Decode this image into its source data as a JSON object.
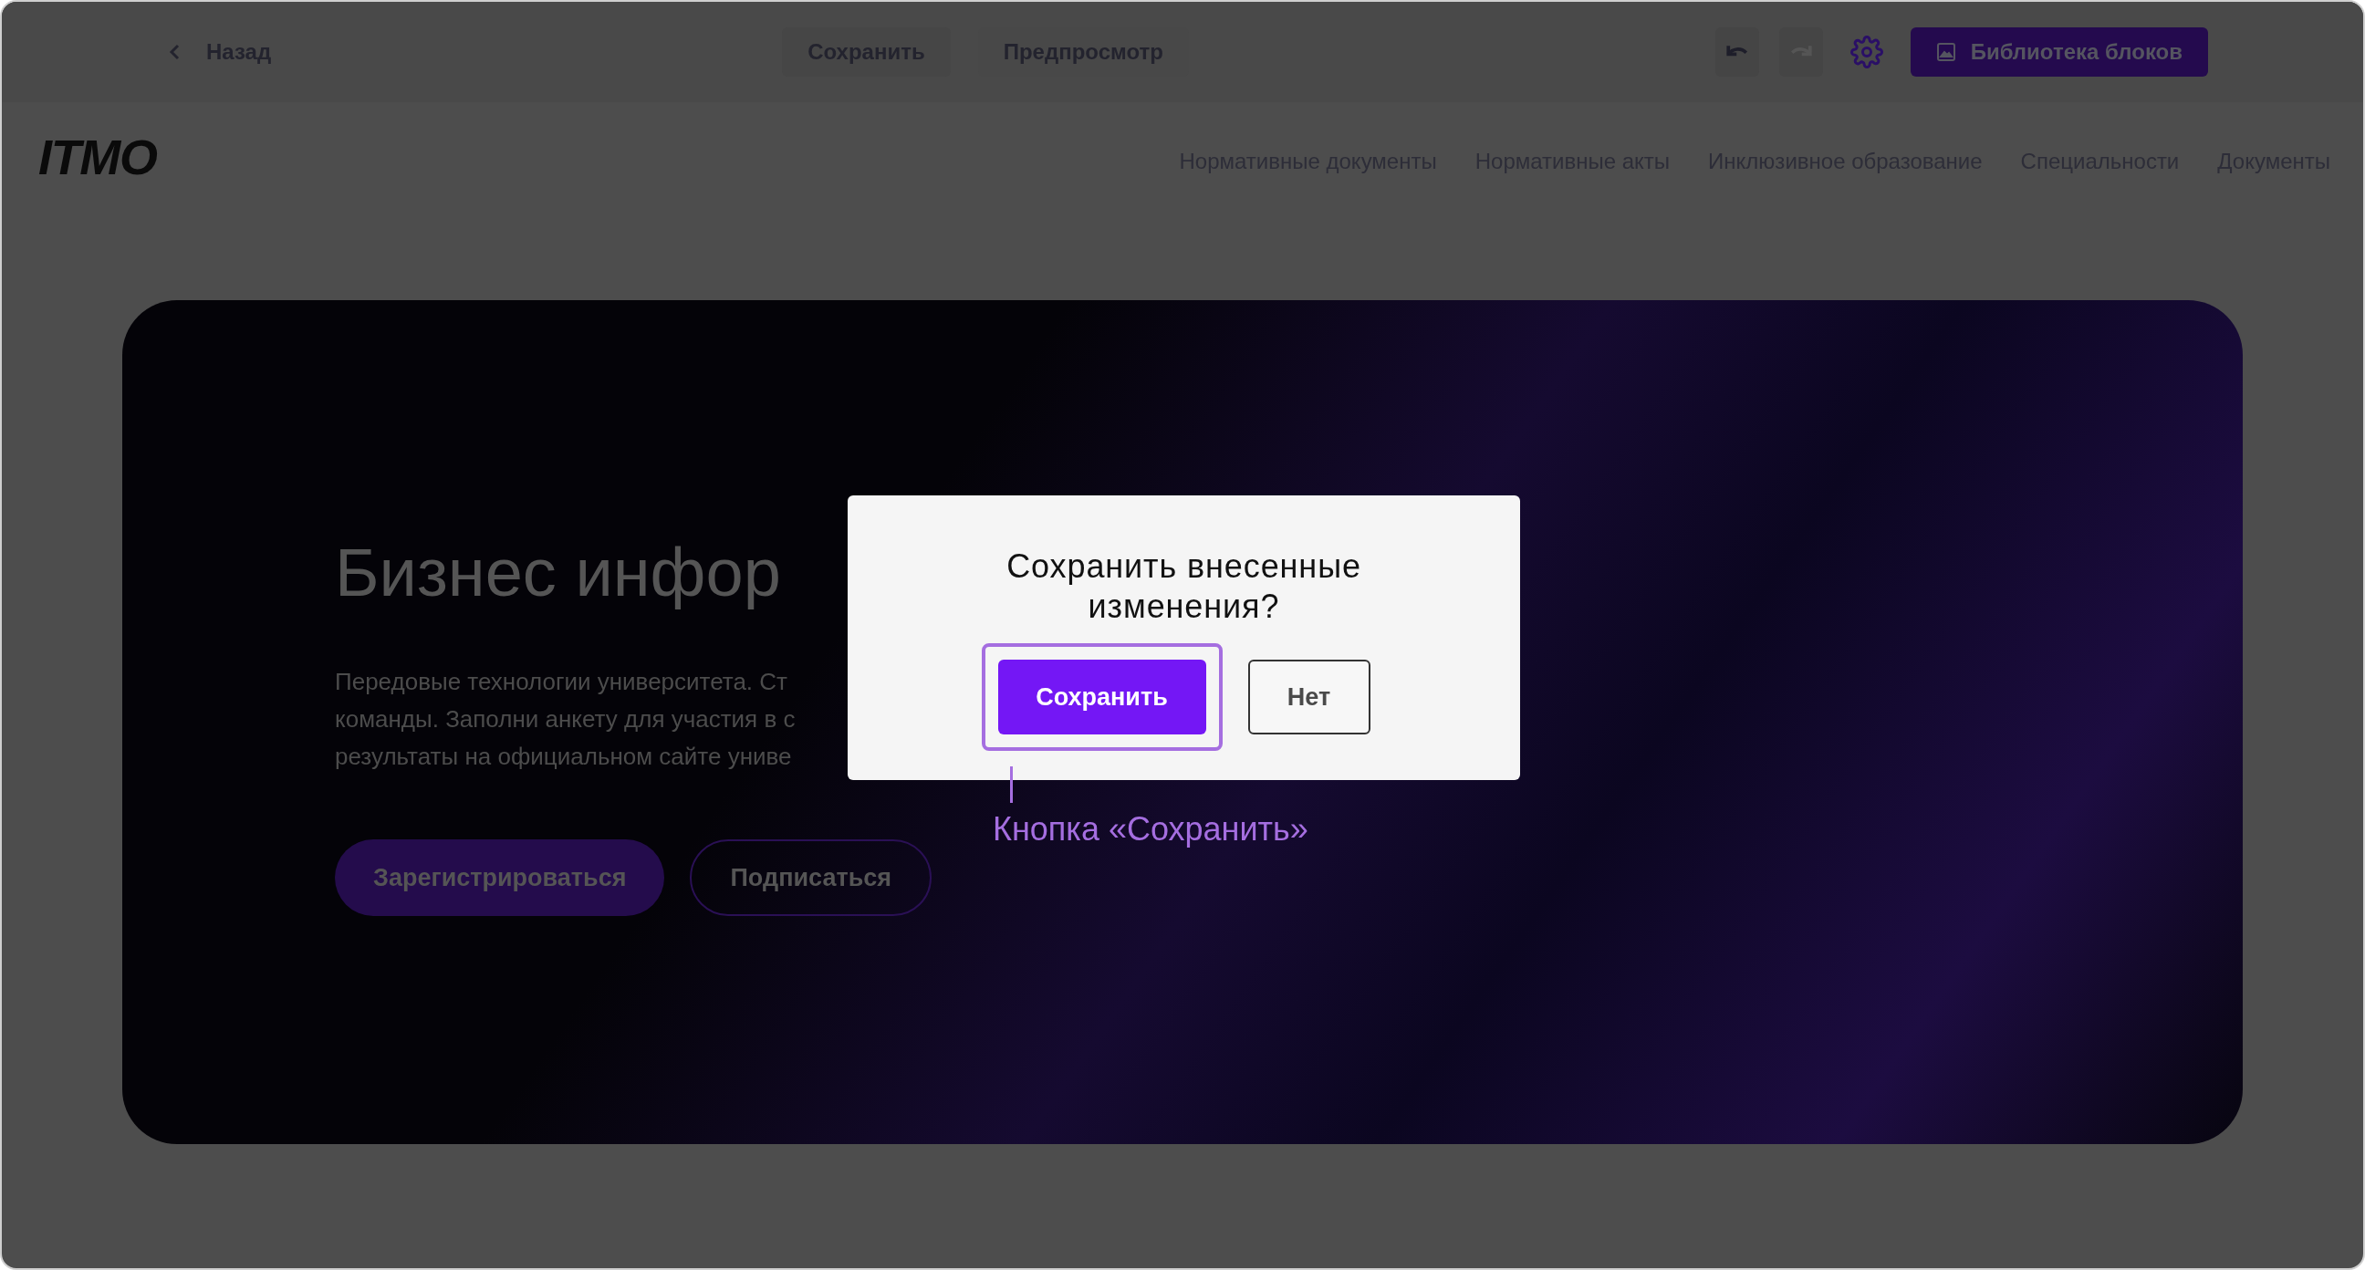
{
  "top_bar": {
    "back": "Назад",
    "save": "Сохранить",
    "preview": "Предпросмотр",
    "undo": {
      "disabled": false
    },
    "redo": {
      "disabled": true
    },
    "library": "Библиотека блоков"
  },
  "site": {
    "logo": "ITMO",
    "nav": [
      "Нормативные документы",
      "Нормативные акты",
      "Инклюзивное образование",
      "Специальности",
      "Документы"
    ]
  },
  "hero": {
    "title": "Бизнес инфор",
    "lines": [
      "Передовые технологии университета. Ст",
      "команды. Заполни анкету для участия в с",
      "результаты на официальном сайте униве"
    ],
    "buttons": [
      {
        "label": "Зарегистрироваться",
        "kind": "primary"
      },
      {
        "label": "Подписаться",
        "kind": "outline"
      }
    ]
  },
  "dialog": {
    "title": "Сохранить внесенные изменения?",
    "buttons": [
      {
        "label": "Сохранить",
        "kind": "primary",
        "highlighted": true
      },
      {
        "label": "Нет",
        "kind": "secondary",
        "highlighted": false
      }
    ]
  },
  "annotation": {
    "label": "Кнопка «Сохранить»"
  }
}
